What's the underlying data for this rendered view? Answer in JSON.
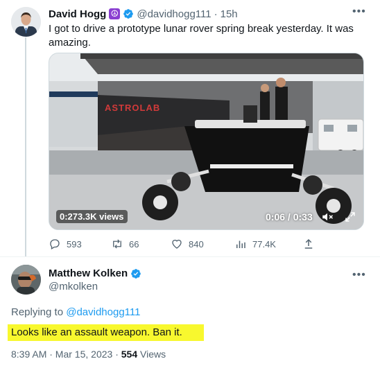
{
  "colors": {
    "accent": "#1d9bf0",
    "muted": "#536471",
    "text": "#0f1419",
    "highlight": "#f8f82e"
  },
  "tweet1": {
    "name": "David Hogg",
    "emoji": "☮",
    "handle": "@davidhogg111",
    "dot": "·",
    "age": "15h",
    "text": "I got to drive a prototype lunar rover spring break yesterday. It was amazing.",
    "video": {
      "view_overlay": "0:273.3K views",
      "elapsed": "0:06",
      "duration": "0:33",
      "time_sep": " / ",
      "brand_text": "ASTROLAB"
    },
    "actions": {
      "replies": "593",
      "retweets": "66",
      "likes": "840",
      "views": "77.4K"
    }
  },
  "tweet2": {
    "name": "Matthew Kolken",
    "handle": "@mkolken",
    "replying_to_label": "Replying to",
    "replying_to_handle": "@davidhogg111",
    "text": "Looks like an assault weapon. Ban it.",
    "timestamp": "8:39 AM · Mar 15, 2023 · ",
    "views_count": "554",
    "views_label": " Views"
  }
}
